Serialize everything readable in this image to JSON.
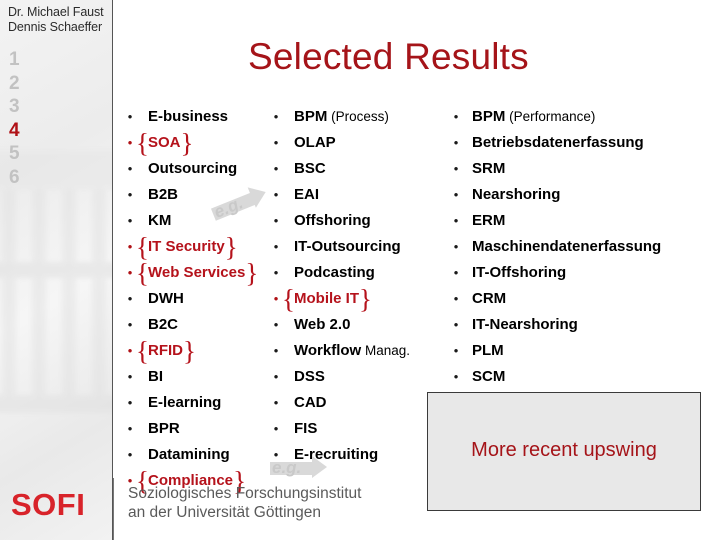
{
  "sidebar": {
    "authors": [
      "Dr. Michael Faust",
      "Dennis Schaeffer"
    ],
    "chapters": [
      {
        "label": "1",
        "active": false
      },
      {
        "label": "2",
        "active": false
      },
      {
        "label": "3",
        "active": false
      },
      {
        "label": "4",
        "active": true
      },
      {
        "label": "5",
        "active": false
      },
      {
        "label": "6",
        "active": false
      }
    ],
    "logo": "SOFI"
  },
  "title": "Selected Results",
  "columns": [
    {
      "name": "column-1",
      "items": [
        {
          "label": "E-business",
          "sub": "",
          "highlight": false,
          "brace": false
        },
        {
          "label": "SOA",
          "sub": "",
          "highlight": true,
          "brace": true
        },
        {
          "label": "Outsourcing",
          "sub": "",
          "highlight": false,
          "brace": false
        },
        {
          "label": "B2B",
          "sub": "",
          "highlight": false,
          "brace": false
        },
        {
          "label": "KM",
          "sub": "",
          "highlight": false,
          "brace": false
        },
        {
          "label": "IT Security",
          "sub": "",
          "highlight": true,
          "brace": true
        },
        {
          "label": "Web Services",
          "sub": "",
          "highlight": true,
          "brace": true
        },
        {
          "label": "DWH",
          "sub": "",
          "highlight": false,
          "brace": false
        },
        {
          "label": "B2C",
          "sub": "",
          "highlight": false,
          "brace": false
        },
        {
          "label": "RFID",
          "sub": "",
          "highlight": true,
          "brace": true
        },
        {
          "label": "BI",
          "sub": "",
          "highlight": false,
          "brace": false
        },
        {
          "label": "E-learning",
          "sub": "",
          "highlight": false,
          "brace": false
        },
        {
          "label": "BPR",
          "sub": "",
          "highlight": false,
          "brace": false
        },
        {
          "label": "Datamining",
          "sub": "",
          "highlight": false,
          "brace": false
        },
        {
          "label": "Compliance",
          "sub": "",
          "highlight": true,
          "brace": true
        }
      ]
    },
    {
      "name": "column-2",
      "items": [
        {
          "label": "BPM",
          "sub": " (Process)",
          "highlight": false,
          "brace": false
        },
        {
          "label": "OLAP",
          "sub": "",
          "highlight": false,
          "brace": false
        },
        {
          "label": "BSC",
          "sub": "",
          "highlight": false,
          "brace": false
        },
        {
          "label": "EAI",
          "sub": "",
          "highlight": false,
          "brace": false
        },
        {
          "label": "Offshoring",
          "sub": "",
          "highlight": false,
          "brace": false
        },
        {
          "label": "IT-Outsourcing",
          "sub": "",
          "highlight": false,
          "brace": false
        },
        {
          "label": "Podcasting",
          "sub": "",
          "highlight": false,
          "brace": false
        },
        {
          "label": "Mobile IT",
          "sub": "",
          "highlight": true,
          "brace": true
        },
        {
          "label": "Web 2.0",
          "sub": "",
          "highlight": false,
          "brace": false
        },
        {
          "label": "Workflow",
          "sub": " Manag.",
          "highlight": false,
          "brace": false
        },
        {
          "label": "DSS",
          "sub": "",
          "highlight": false,
          "brace": false
        },
        {
          "label": "CAD",
          "sub": "",
          "highlight": false,
          "brace": false
        },
        {
          "label": "FIS",
          "sub": "",
          "highlight": false,
          "brace": false
        },
        {
          "label": "E-recruiting",
          "sub": "",
          "highlight": false,
          "brace": false
        }
      ]
    },
    {
      "name": "column-3",
      "items": [
        {
          "label": "BPM",
          "sub": " (Performance)",
          "highlight": false,
          "brace": false
        },
        {
          "label": "Betriebsdatenerfassung",
          "sub": "",
          "highlight": false,
          "brace": false
        },
        {
          "label": "SRM",
          "sub": "",
          "highlight": false,
          "brace": false
        },
        {
          "label": "Nearshoring",
          "sub": "",
          "highlight": false,
          "brace": false
        },
        {
          "label": "ERM",
          "sub": "",
          "highlight": false,
          "brace": false
        },
        {
          "label": "Maschinendatenerfassung",
          "sub": "",
          "highlight": false,
          "brace": false
        },
        {
          "label": "IT-Offshoring",
          "sub": "",
          "highlight": false,
          "brace": false
        },
        {
          "label": "CRM",
          "sub": "",
          "highlight": false,
          "brace": false
        },
        {
          "label": "IT-Nearshoring",
          "sub": "",
          "highlight": false,
          "brace": false
        },
        {
          "label": "PLM",
          "sub": "",
          "highlight": false,
          "brace": false
        },
        {
          "label": "SCM",
          "sub": "",
          "highlight": false,
          "brace": false
        }
      ]
    }
  ],
  "annotations": {
    "eg_label_1": "e.g.",
    "eg_label_2": "e.g."
  },
  "callout": {
    "text": "More recent upswing"
  },
  "footer": {
    "lines": [
      "Soziologisches Forschungsinstitut",
      "an der Universität Göttingen"
    ]
  },
  "bullet_glyph": "•",
  "brace_left": "{",
  "brace_right": "}",
  "colors": {
    "title_red": "#a51419",
    "highlight_red": "#b5121b",
    "logo_red": "#d8232a",
    "chapter_gray": "#c2c2c2",
    "callout_bg": "#e8e8e8",
    "footer_gray": "#5a5a5a"
  }
}
